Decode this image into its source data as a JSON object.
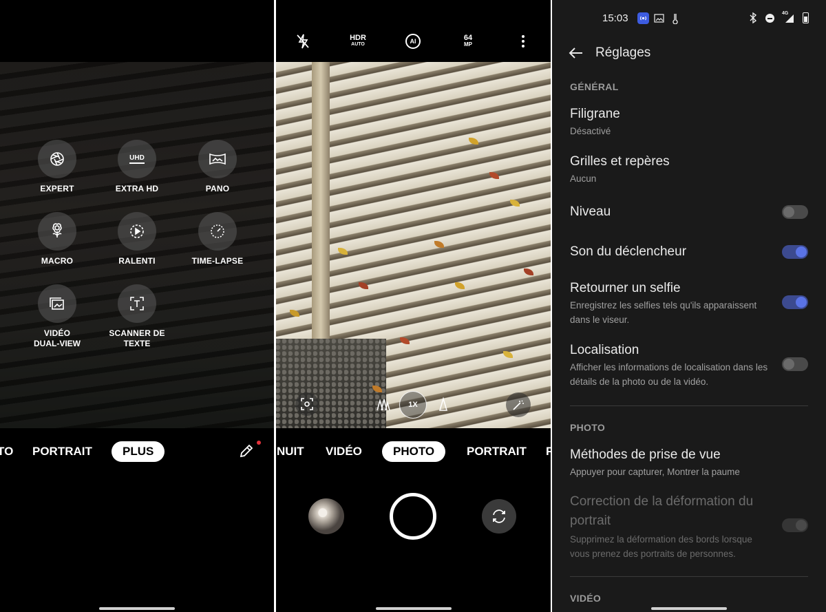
{
  "panel_modes": {
    "modes": [
      {
        "label": "EXPERT",
        "icon": "aperture-icon"
      },
      {
        "label": "EXTRA HD",
        "icon": "uhd-icon",
        "icon_text": "UHD"
      },
      {
        "label": "PANO",
        "icon": "panorama-icon"
      },
      {
        "label": "MACRO",
        "icon": "flower-icon"
      },
      {
        "label": "RALENTI",
        "icon": "slow-motion-icon"
      },
      {
        "label": "TIME-LAPSE",
        "icon": "timelapse-icon"
      },
      {
        "label": "VIDÉO",
        "label2": "DUAL-VIEW",
        "icon": "dual-view-icon"
      },
      {
        "label": "SCANNER DE",
        "label2": "TEXTE",
        "icon": "text-scanner-icon"
      }
    ],
    "mode_bar": {
      "partial": "TO",
      "portrait": "PORTRAIT",
      "active": "PLUS"
    },
    "edit_icon": "pencil-icon",
    "notification_dot_color": "#e5323b"
  },
  "panel_camera": {
    "top_bar": {
      "flash_icon": "flash-off-icon",
      "hdr_label": "HDR",
      "hdr_sub": "AUTO",
      "ai_label": "AI",
      "resolution_label": "64",
      "resolution_sub": "MP",
      "more_icon": "more-vertical-icon"
    },
    "zoom": {
      "label": "1X"
    },
    "mode_bar": {
      "items": [
        "NUIT",
        "VIDÉO",
        "PHOTO",
        "PORTRAIT",
        "P"
      ],
      "active": "PHOTO"
    }
  },
  "panel_settings": {
    "status_bar": {
      "time": "15:03",
      "network": "4G"
    },
    "title": "Réglages",
    "sections": {
      "general": "GÉNÉRAL",
      "photo": "PHOTO",
      "video": "VIDÉO"
    },
    "rows": {
      "filigrane": {
        "title": "Filigrane",
        "value": "Désactivé"
      },
      "grilles": {
        "title": "Grilles et repères",
        "value": "Aucun"
      },
      "niveau": {
        "title": "Niveau",
        "enabled": false
      },
      "son": {
        "title": "Son du déclencheur",
        "enabled": true
      },
      "selfie": {
        "title": "Retourner un selfie",
        "desc": "Enregistrez les selfies tels qu'ils apparaissent dans le viseur.",
        "enabled": true
      },
      "localisation": {
        "title": "Localisation",
        "desc": "Afficher les informations de localisation dans les détails de la photo ou de la vidéo.",
        "enabled": false
      },
      "methodes": {
        "title": "Méthodes de prise de vue",
        "value": "Appuyer pour capturer, Montrer la paume"
      },
      "correction": {
        "title": "Correction de la déformation du portrait",
        "desc": "Supprimez la déformation des bords lorsque vous prenez des portraits de personnes.",
        "disabled": true
      }
    },
    "accent_color": "#5a73e6"
  }
}
